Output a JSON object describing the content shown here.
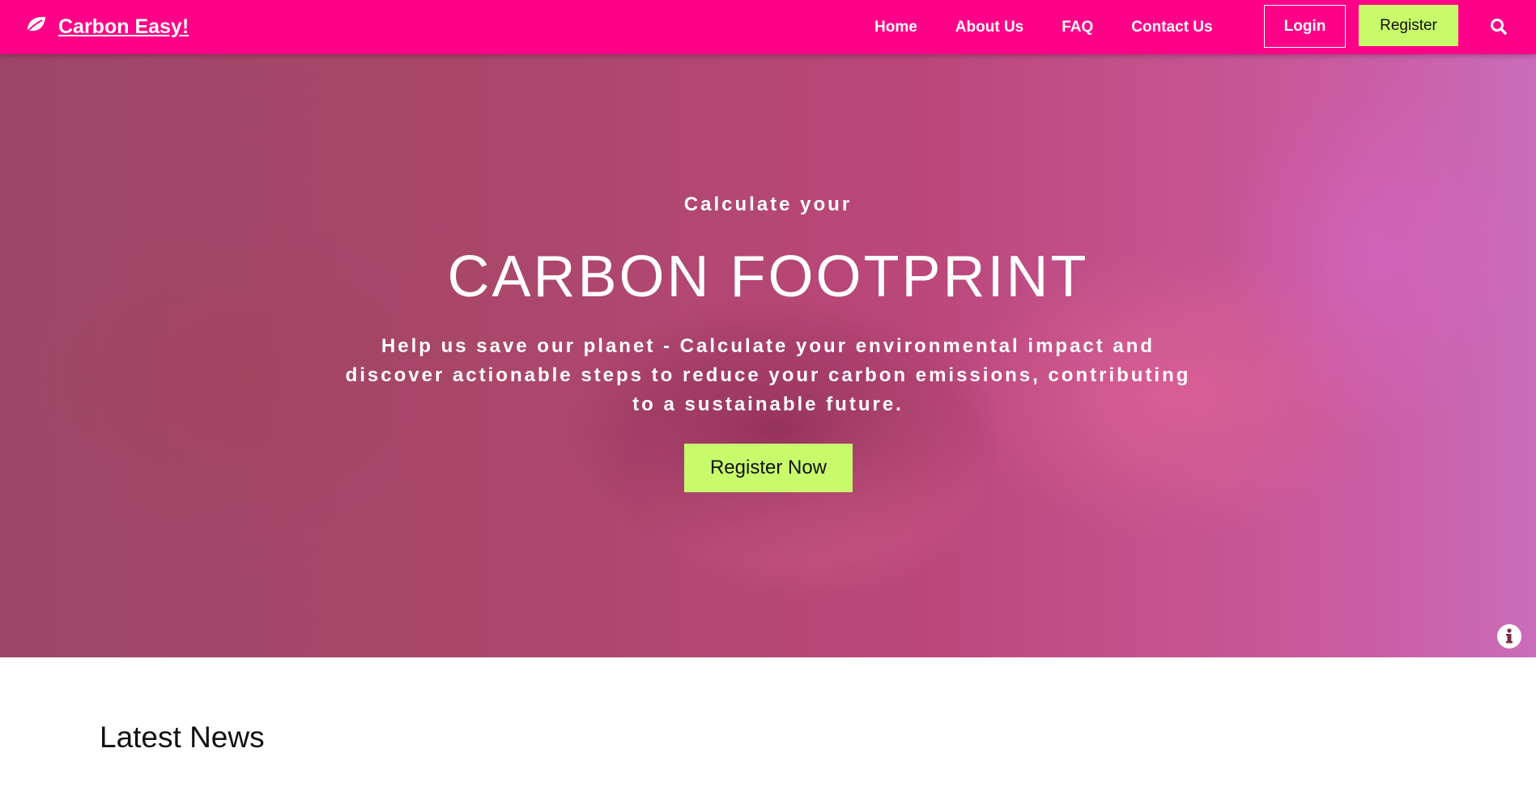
{
  "brand": {
    "name": "Carbon Easy!",
    "icon": "leaf-icon"
  },
  "nav": {
    "links": [
      "Home",
      "About Us",
      "FAQ",
      "Contact Us"
    ],
    "login_label": "Login",
    "register_label": "Register",
    "search_icon": "search-icon"
  },
  "hero": {
    "pre_title": "Calculate your",
    "title": "CARBON FOOTPRINT",
    "description": "Help us save our planet - Calculate your environmental impact and discover actionable steps to reduce your carbon emissions, contributing to a sustainable future.",
    "cta_label": "Register Now",
    "info_icon": "info-icon"
  },
  "news": {
    "title": "Latest News"
  },
  "colors": {
    "primary": "#ff0088",
    "accent": "#c8fb6c",
    "text_light": "#ffffff",
    "text_dark": "#111111"
  }
}
